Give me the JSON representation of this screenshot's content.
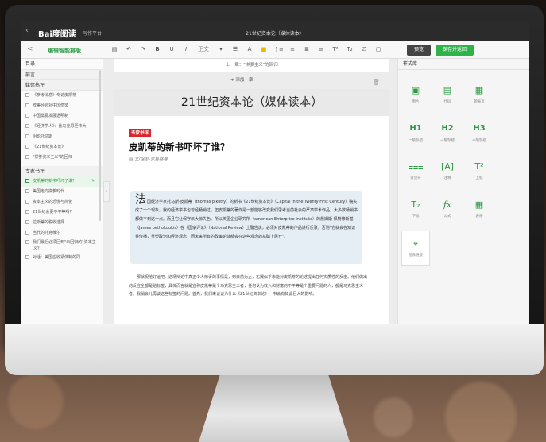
{
  "app": {
    "logo": "Bai度阅读",
    "subtitle": "写作平台",
    "window_title": "21世纪资本论（媒体读本）"
  },
  "toolbar": {
    "back_label": "<",
    "mode_label": "编辑智能排版",
    "tools": [
      "▤",
      "↶",
      "↷",
      "B",
      "U",
      "I",
      "正文",
      "▾",
      "☰",
      "A",
      "▆",
      "⋮≡",
      "≡",
      "≣",
      "≡",
      "T²",
      "T₂",
      "∅",
      "▢"
    ],
    "preview_label": "预览",
    "save_label": "保存并返回"
  },
  "sidebar": {
    "header": "目录",
    "section1": "前言",
    "section2": "媒体热评",
    "items_top": [
      "《参考消息》专访皮凯蒂",
      "欧美经验对中国借鉴",
      "中国需要发展透明制",
      "《经济学人》：比马克思更伟大",
      "阴影托马斯",
      "《21世纪资本论》",
      "\"拼爹资本主义\"的回归"
    ],
    "section3": "专家书评",
    "items_bottom": [
      "皮凯蒂的新书吓坏了谁？",
      "美国走向拼爹时代",
      "资本主义的恐慌与简化",
      "21世纪会更不平等吗？",
      "拉斯蒂的税收选择",
      "当代的托克维尔",
      "我们最后必须回到\"未回归的\"资本主义？",
      "对话：美国应收紧体制的同"
    ],
    "collapse_label": "›"
  },
  "editor": {
    "context_text": "上一章：\"拼爹主义\"的回归",
    "add_para": "+ 添加一章",
    "doc_title": "21世纪资本论（媒体读本）",
    "tag": "专家书评",
    "headline": "皮凯蒂的新书吓坏了谁？",
    "byline": "▤ 文/保罗·克鲁格曼",
    "dropcap": "法",
    "quote_body": "国经济学家托马斯·皮凯蒂（thomas piketty）的新书《21世纪资本论》（Capital in the Twenty-First Century）确实成了一个现象。我的经济学书也曾经畅销过，但皮凯蒂的著作是一部能够改变我们思考当前社会的严肃学术作品，大多数畅销书都做不到这一点。而且它让保守派大惊失色。所以美国企业研究所（american Enterprise institute）的詹姆斯·佩特修斯基（James pethokoukis）在《国家评论》（National Review）上警告说，必须对皮凯蒂的作品进行反驳，否则\"它就会在知识界传播，重塑政治和经济观念，而未来所有的政策论战都会在这些观念的基础上展开\"。",
    "body_text": "那就祝他好运吧。这场辩论中真正令人惊讶的事情是，到目前为止，右翼似乎未能对皮凯蒂的论述提出任何实质性的反击。他们做出的反应全都是贴标签，具体而言就是宣称皮凯蒂是个马克思主义者，任何认为收入和财富的不平等是个重要问题的人，都是马克思主义者。我稍会儿再谈这些标签的问题。首先，我们来谈谈为什么《21世纪资本论》一书会有如此巨大的影响。"
  },
  "right_panel": {
    "header": "样式库",
    "tiles": [
      {
        "icon": "▣",
        "label": "图片"
      },
      {
        "icon": "▤",
        "label": "代码"
      },
      {
        "icon": "▦",
        "label": "题表页"
      },
      {
        "icon": "H1",
        "label": "一级标题"
      },
      {
        "icon": "H2",
        "label": "二级标题"
      },
      {
        "icon": "H3",
        "label": "三级标题"
      },
      {
        "icon": "⩶",
        "label": "分页符"
      },
      {
        "icon": "[A]",
        "label": "注释"
      },
      {
        "icon": "T²",
        "label": "上标"
      },
      {
        "icon": "T₂",
        "label": "下标"
      },
      {
        "icon": "fx",
        "label": "公式"
      },
      {
        "icon": "▦",
        "label": "表格"
      },
      {
        "icon": "⌖",
        "label": "图像链接"
      }
    ]
  }
}
